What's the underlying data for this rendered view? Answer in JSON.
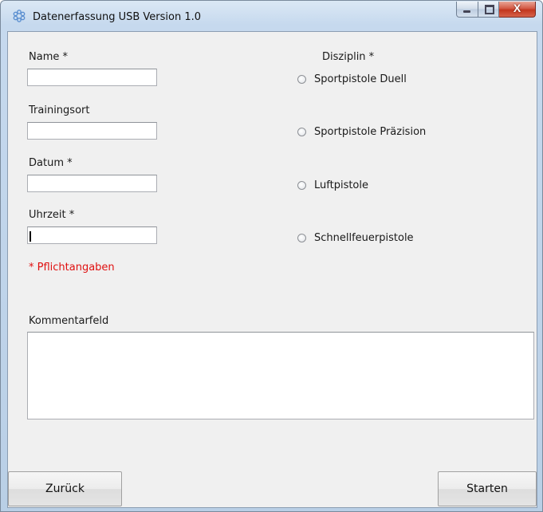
{
  "window": {
    "title": "Datenerfassung USB Version 1.0",
    "icon": "snowflake-app-icon",
    "controls": [
      "minimize-icon",
      "maximize-icon",
      "close-icon"
    ],
    "close_glyph": "X"
  },
  "form": {
    "name_label": "Name",
    "name_value": "",
    "trainingsort_label": "Trainingsort",
    "trainingsort_value": "",
    "datum_label": "Datum",
    "datum_value": "",
    "uhrzeit_label": "Uhrzeit",
    "uhrzeit_value": "",
    "required_marker": " *",
    "required_note": "* Pflichtangaben",
    "required_color": "#e01010"
  },
  "disziplin": {
    "label": "Disziplin *",
    "options": [
      {
        "label": "Sportpistole Duell",
        "selected": false
      },
      {
        "label": "Sportpistole Präzision",
        "selected": false
      },
      {
        "label": "Luftpistole",
        "selected": false
      },
      {
        "label": "Schnellfeuerpistole",
        "selected": false
      }
    ]
  },
  "kommentar": {
    "label": "Kommentarfeld",
    "value": ""
  },
  "buttons": {
    "back_label": "Zurück",
    "start_label": "Starten"
  }
}
